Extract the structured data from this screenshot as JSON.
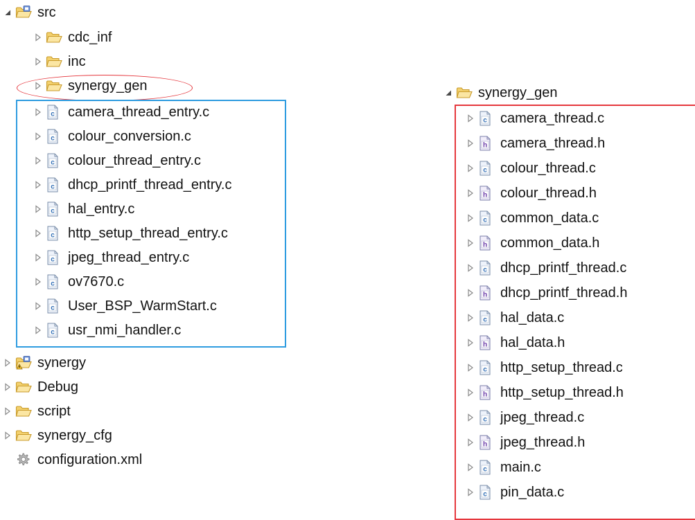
{
  "left_tree": {
    "root": {
      "label": "src",
      "expanded": true
    },
    "folders": [
      {
        "label": "cdc_inf"
      },
      {
        "label": "inc"
      },
      {
        "label": "synergy_gen"
      }
    ],
    "files": [
      {
        "label": "camera_thread_entry.c",
        "ext": "c"
      },
      {
        "label": "colour_conversion.c",
        "ext": "c"
      },
      {
        "label": "colour_thread_entry.c",
        "ext": "c"
      },
      {
        "label": "dhcp_printf_thread_entry.c",
        "ext": "c"
      },
      {
        "label": "hal_entry.c",
        "ext": "c"
      },
      {
        "label": "http_setup_thread_entry.c",
        "ext": "c"
      },
      {
        "label": "jpeg_thread_entry.c",
        "ext": "c"
      },
      {
        "label": "ov7670.c",
        "ext": "c"
      },
      {
        "label": "User_BSP_WarmStart.c",
        "ext": "c"
      },
      {
        "label": "usr_nmi_handler.c",
        "ext": "c"
      }
    ],
    "siblings": [
      {
        "label": "synergy",
        "icon": "package-folder-icon"
      },
      {
        "label": "Debug",
        "icon": "folder-icon"
      },
      {
        "label": "script",
        "icon": "folder-icon"
      },
      {
        "label": "synergy_cfg",
        "icon": "folder-icon"
      },
      {
        "label": "configuration.xml",
        "icon": "gear-icon"
      }
    ]
  },
  "right_tree": {
    "root": {
      "label": "synergy_gen",
      "expanded": true
    },
    "files": [
      {
        "label": "camera_thread.c",
        "ext": "c"
      },
      {
        "label": "camera_thread.h",
        "ext": "h"
      },
      {
        "label": "colour_thread.c",
        "ext": "c"
      },
      {
        "label": "colour_thread.h",
        "ext": "h"
      },
      {
        "label": "common_data.c",
        "ext": "c"
      },
      {
        "label": "common_data.h",
        "ext": "h"
      },
      {
        "label": "dhcp_printf_thread.c",
        "ext": "c"
      },
      {
        "label": "dhcp_printf_thread.h",
        "ext": "h"
      },
      {
        "label": "hal_data.c",
        "ext": "c"
      },
      {
        "label": "hal_data.h",
        "ext": "h"
      },
      {
        "label": "http_setup_thread.c",
        "ext": "c"
      },
      {
        "label": "http_setup_thread.h",
        "ext": "h"
      },
      {
        "label": "jpeg_thread.c",
        "ext": "c"
      },
      {
        "label": "jpeg_thread.h",
        "ext": "h"
      },
      {
        "label": "main.c",
        "ext": "c"
      },
      {
        "label": "pin_data.c",
        "ext": "c"
      }
    ]
  },
  "colors": {
    "highlight_blue": "#2e9ce0",
    "highlight_red": "#e5373d",
    "folder_fill": "#f6d87c",
    "folder_stroke": "#c89a2a",
    "file_c_letter": "#2f6db5",
    "file_h_letter": "#6a3aa8",
    "twisty": "#8a8a8a"
  }
}
